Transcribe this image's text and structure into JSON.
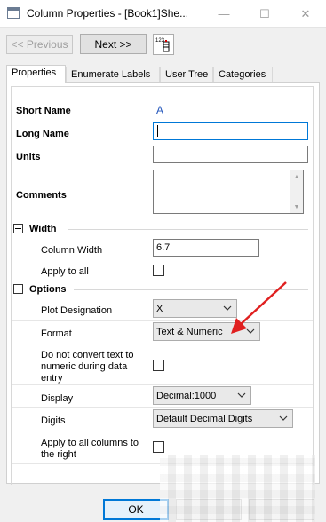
{
  "window": {
    "title": "Column Properties - [Book1]She...",
    "minimize_glyph": "—",
    "maximize_glyph": "☐",
    "close_glyph": "✕"
  },
  "toolbar": {
    "previous_label": "<< Previous",
    "next_label": "Next >>",
    "icon_text": "123"
  },
  "tabs": [
    {
      "label": "Properties",
      "active": true
    },
    {
      "label": "Enumerate Labels",
      "active": false
    },
    {
      "label": "User Tree",
      "active": false
    },
    {
      "label": "Categories",
      "active": false
    }
  ],
  "properties": {
    "short_name_label": "Short Name",
    "short_name_value": "A",
    "long_name_label": "Long Name",
    "long_name_value": "",
    "units_label": "Units",
    "units_value": "",
    "comments_label": "Comments",
    "comments_value": ""
  },
  "width_section": {
    "title": "Width",
    "column_width_label": "Column Width",
    "column_width_value": "6.7",
    "apply_all_label": "Apply to all",
    "apply_all_checked": false
  },
  "options_section": {
    "title": "Options",
    "plot_designation_label": "Plot Designation",
    "plot_designation_value": "X",
    "format_label": "Format",
    "format_value": "Text & Numeric",
    "no_convert_label_line1": "Do not convert text to",
    "no_convert_label_line2": "numeric during data",
    "no_convert_label_line3": "entry",
    "no_convert_checked": false,
    "display_label": "Display",
    "display_value": "Decimal:1000",
    "digits_label": "Digits",
    "digits_value": "Default Decimal Digits",
    "apply_right_label_line1": "Apply to all columns to",
    "apply_right_label_line2": "the right",
    "apply_right_checked": false
  },
  "footer": {
    "ok_label": "OK"
  },
  "colors": {
    "annotation_arrow": "#e02020",
    "short_name_value": "#2255bb",
    "focus_border": "#0078d7"
  }
}
